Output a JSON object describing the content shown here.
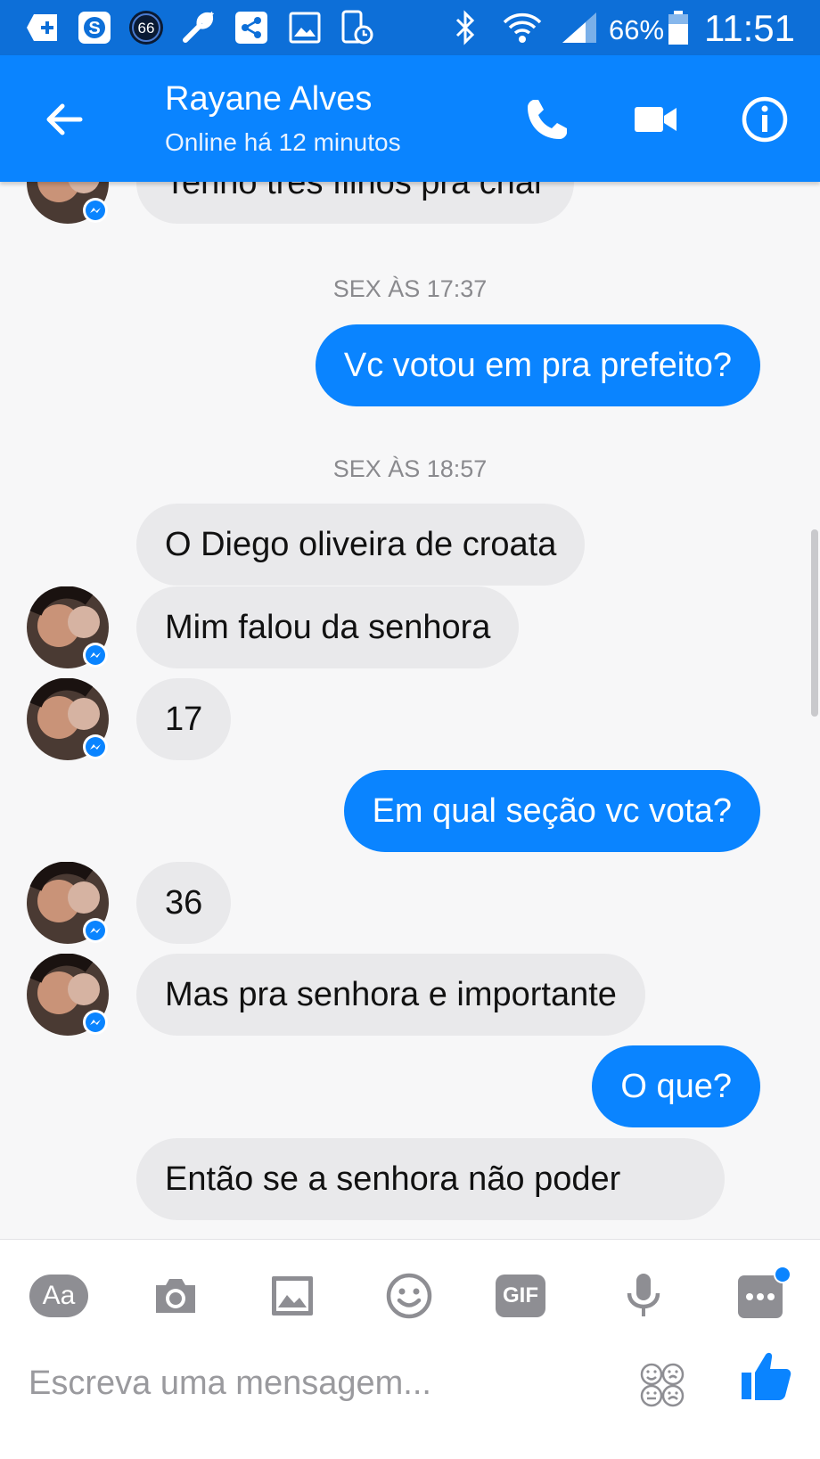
{
  "status_bar": {
    "notif_badge": "66",
    "battery": "66%",
    "time": "11:51"
  },
  "header": {
    "name": "Rayane Alves",
    "status": "Online há 12 minutos"
  },
  "conversation": {
    "m0": "Tenho três filhos pra criar",
    "ts1": "SEX ÀS 17:37",
    "m1": "Vc votou em pra prefeito?",
    "ts2": "SEX ÀS 18:57",
    "m2": "O Diego oliveira de croata",
    "m3": "Mim falou da senhora",
    "m4": "17",
    "m5": "Em qual seção vc vota?",
    "m6": "36",
    "m7": "Mas pra senhora e importante",
    "m8": "O que?",
    "m9": "Então se a senhora não poder"
  },
  "composer": {
    "aa_label": "Aa",
    "gif_label": "GIF",
    "placeholder": "Escreva uma mensagem..."
  },
  "colors": {
    "status_bar": "#0d6fd8",
    "app_bar": "#0a84ff",
    "outgoing_bubble": "#0a84ff",
    "incoming_bubble": "#e9e9eb"
  }
}
